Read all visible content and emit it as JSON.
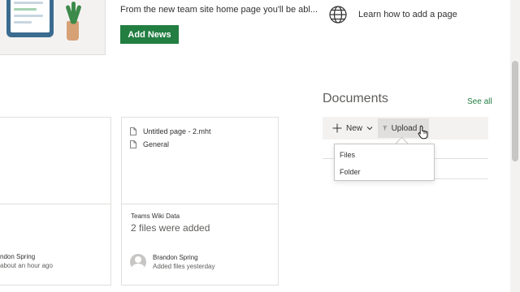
{
  "news": {
    "description": "From the new team site home page you'll be abl...",
    "add_button": "Add News"
  },
  "quick_link": {
    "icon": "globe-icon",
    "label": "Learn how to add a page"
  },
  "activity": {
    "left_card": {
      "person": "ndon Spring",
      "meta": "about an hour ago"
    },
    "mid_card": {
      "files": [
        "Untitled page - 2.mht",
        "General"
      ],
      "title": "Teams Wiki Data",
      "subtitle": "2 files were added",
      "person": "Brandon Spring",
      "meta": "Added files yesterday"
    }
  },
  "documents": {
    "title": "Documents",
    "see_all": "See all",
    "toolbar": {
      "new_label": "New",
      "upload_label": "Upload"
    },
    "upload_menu": [
      "Files",
      "Folder"
    ]
  },
  "colors": {
    "accent": "#227e41",
    "command_bar": "#f3f2f1"
  }
}
